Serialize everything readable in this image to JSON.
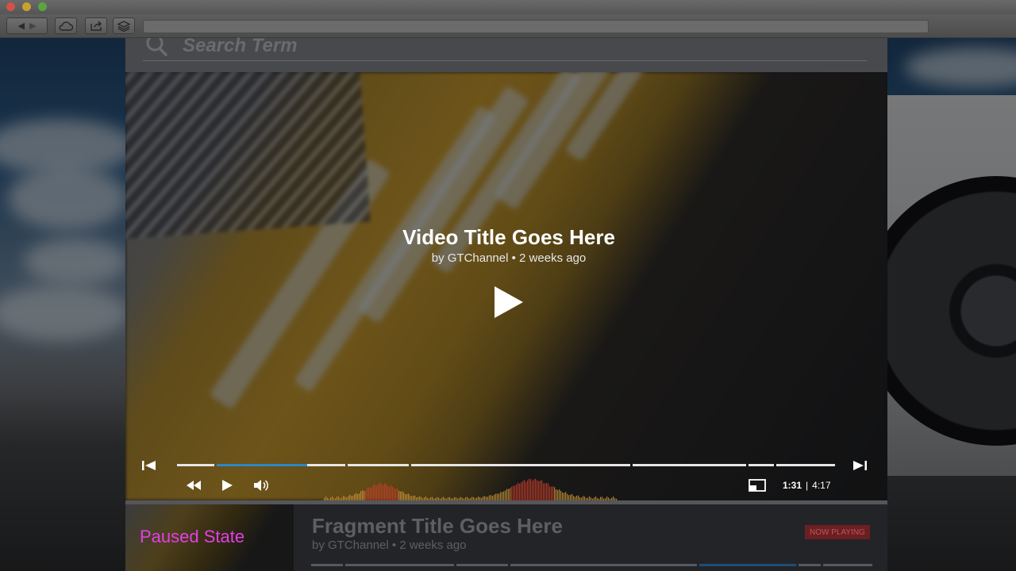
{
  "search": {
    "placeholder": "Search Term"
  },
  "video": {
    "title": "Video Title Goes Here",
    "meta": "by GTChannel • 2 weeks ago",
    "current_time": "1:31",
    "separator": "|",
    "duration": "4:17",
    "progress_fraction": 0.22,
    "accent_color": "#2e86c6"
  },
  "controls": {
    "icons": [
      "skip-back-icon",
      "skip-forward-icon",
      "rewind-icon",
      "play-icon",
      "volume-icon",
      "pip-icon"
    ]
  },
  "fragment": {
    "title": "Fragment Title Goes Here",
    "meta": "by GTChannel • 2 weeks ago",
    "badge": "NOW PLAYING",
    "badge_color": "#6b1f22"
  },
  "state_label": "Paused State",
  "state_label_color": "#e43ee8"
}
